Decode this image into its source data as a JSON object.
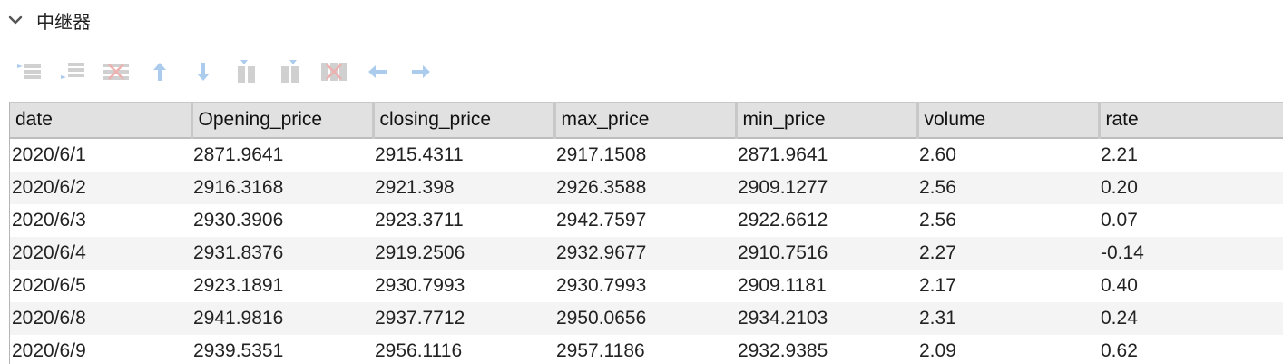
{
  "header": {
    "title": "中继器"
  },
  "toolbar": {
    "icons": [
      "insert-row-above-icon",
      "insert-row-below-icon",
      "delete-row-icon",
      "move-up-icon",
      "move-down-icon",
      "insert-column-left-icon",
      "insert-column-right-icon",
      "delete-column-icon",
      "move-left-icon",
      "move-right-icon"
    ]
  },
  "table": {
    "columns": [
      "date",
      "Opening_price",
      "closing_price",
      "max_price",
      "min_price",
      "volume",
      "rate"
    ],
    "rows": [
      [
        "2020/6/1",
        "2871.9641",
        "2915.4311",
        "2917.1508",
        "2871.9641",
        "2.60",
        "2.21"
      ],
      [
        "2020/6/2",
        "2916.3168",
        "2921.398",
        "2926.3588",
        "2909.1277",
        "2.56",
        "0.20"
      ],
      [
        "2020/6/3",
        "2930.3906",
        "2923.3711",
        "2942.7597",
        "2922.6612",
        "2.56",
        "0.07"
      ],
      [
        "2020/6/4",
        "2931.8376",
        "2919.2506",
        "2932.9677",
        "2910.7516",
        "2.27",
        "-0.14"
      ],
      [
        "2020/6/5",
        "2923.1891",
        "2930.7993",
        "2930.7993",
        "2909.1181",
        "2.17",
        "0.40"
      ],
      [
        "2020/6/8",
        "2941.9816",
        "2937.7712",
        "2950.0656",
        "2934.2103",
        "2.31",
        "0.24"
      ],
      [
        "2020/6/9",
        "2939.5351",
        "2956.1116",
        "2957.1186",
        "2932.9385",
        "2.09",
        "0.62"
      ]
    ]
  },
  "colors": {
    "header_bg": "#e1e1e1",
    "stripe": "#f4f4f4",
    "icon_blue": "#4a90d9",
    "icon_red": "#d9534f"
  }
}
